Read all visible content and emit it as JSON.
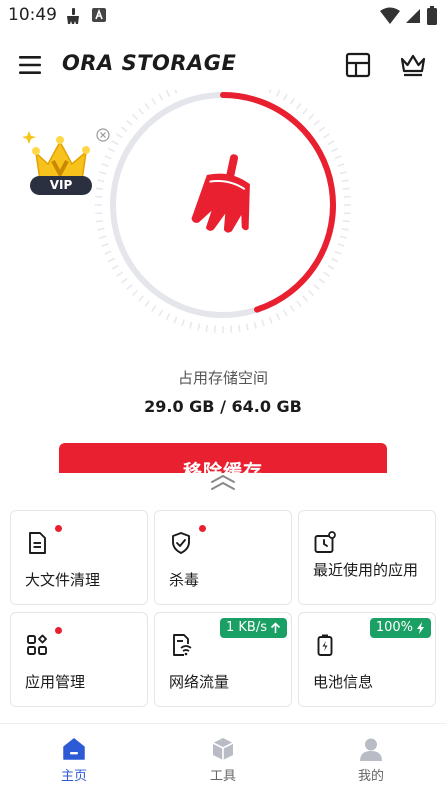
{
  "status_bar": {
    "time": "10:49"
  },
  "header": {
    "title": "ORA STORAGE"
  },
  "hero": {
    "vip_label": "VIP",
    "storage_caption": "占用存储空间",
    "storage_used": "29.0 GB",
    "storage_total": "64.0 GB",
    "storage_value": "29.0 GB / 64.0 GB",
    "usage_fraction": 0.45,
    "clean_button_label": "移除缓存"
  },
  "tools": [
    {
      "label": "大文件清理",
      "icon": "document-icon",
      "has_dot": true
    },
    {
      "label": "杀毒",
      "icon": "shield-check-icon",
      "has_dot": true
    },
    {
      "label": "最近使用的应用",
      "icon": "recent-apps-icon",
      "has_dot": false
    },
    {
      "label": "应用管理",
      "icon": "apps-grid-icon",
      "has_dot": true
    },
    {
      "label": "网络流量",
      "icon": "network-traffic-icon",
      "has_dot": false,
      "badge": "1 KB/s"
    },
    {
      "label": "电池信息",
      "icon": "battery-icon",
      "has_dot": false,
      "badge": "100%"
    }
  ],
  "bottom_nav": [
    {
      "label": "主页",
      "icon": "home-icon",
      "active": true
    },
    {
      "label": "工具",
      "icon": "tools-box-icon",
      "active": false
    },
    {
      "label": "我的",
      "icon": "profile-icon",
      "active": false
    }
  ],
  "colors": {
    "accent_red": "#e8202f",
    "active_blue": "#2d5bd6",
    "badge_green": "#1aa064",
    "gauge_track": "#e4e6ec"
  }
}
